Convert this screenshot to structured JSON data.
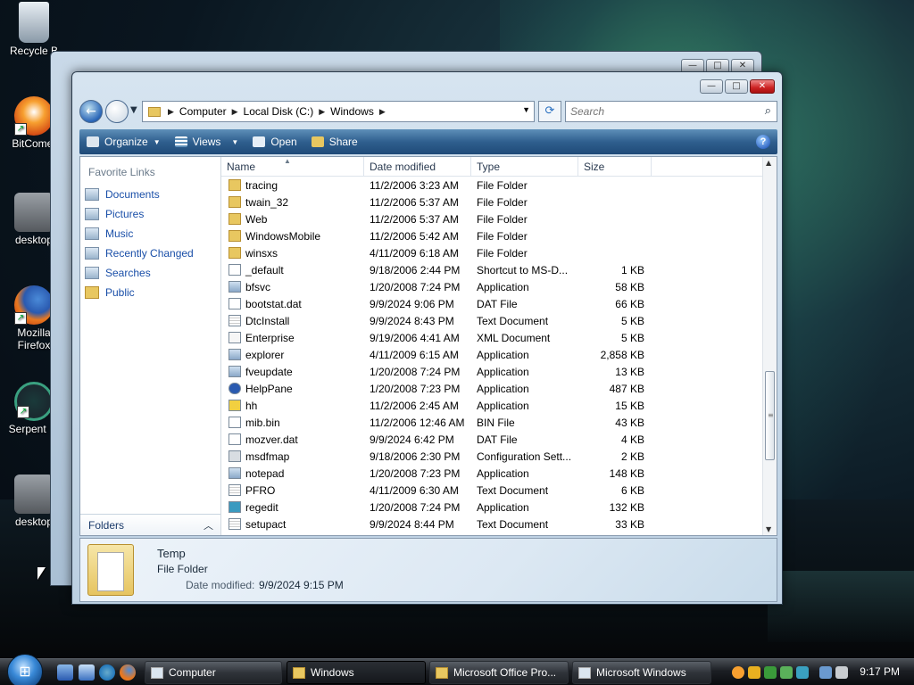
{
  "desktop": {
    "icons": [
      {
        "label": "Recycle B",
        "icon": "recycle-bin-icon"
      },
      {
        "label": "BitComet",
        "icon": "bitcomet-icon"
      },
      {
        "label": "desktop",
        "icon": "gear-file-icon"
      },
      {
        "label": "Mozilla Firefox",
        "icon": "firefox-icon"
      },
      {
        "label": "Serpent IA",
        "icon": "serpent-icon"
      },
      {
        "label": "desktop",
        "icon": "gear-file-icon"
      }
    ]
  },
  "window": {
    "caption_buttons": {
      "minimize": "—",
      "maximize": "□",
      "close": "✕"
    },
    "address": {
      "parts": [
        "Computer",
        "Local Disk (C:)",
        "Windows"
      ]
    },
    "search": {
      "placeholder": "Search"
    },
    "toolbar": {
      "organize": "Organize",
      "views": "Views",
      "open": "Open",
      "share": "Share",
      "help": "?"
    },
    "left_pane": {
      "title": "Favorite Links",
      "links": [
        "Documents",
        "Pictures",
        "Music",
        "Recently Changed",
        "Searches",
        "Public"
      ],
      "folders_label": "Folders"
    },
    "columns": {
      "name": "Name",
      "date": "Date modified",
      "type": "Type",
      "size": "Size"
    },
    "files": [
      {
        "name": "tracing",
        "date": "11/2/2006 3:23 AM",
        "type": "File Folder",
        "size": "",
        "icon": "folder"
      },
      {
        "name": "twain_32",
        "date": "11/2/2006 5:37 AM",
        "type": "File Folder",
        "size": "",
        "icon": "folder"
      },
      {
        "name": "Web",
        "date": "11/2/2006 5:37 AM",
        "type": "File Folder",
        "size": "",
        "icon": "folder"
      },
      {
        "name": "WindowsMobile",
        "date": "11/2/2006 5:42 AM",
        "type": "File Folder",
        "size": "",
        "icon": "folder"
      },
      {
        "name": "winsxs",
        "date": "4/11/2009 6:18 AM",
        "type": "File Folder",
        "size": "",
        "icon": "folder"
      },
      {
        "name": "_default",
        "date": "9/18/2006 2:44 PM",
        "type": "Shortcut to MS-D...",
        "size": "1 KB",
        "icon": "shortcut"
      },
      {
        "name": "bfsvc",
        "date": "1/20/2008 7:24 PM",
        "type": "Application",
        "size": "58 KB",
        "icon": "app"
      },
      {
        "name": "bootstat.dat",
        "date": "9/9/2024 9:06 PM",
        "type": "DAT File",
        "size": "66 KB",
        "icon": "dat"
      },
      {
        "name": "DtcInstall",
        "date": "9/9/2024 8:43 PM",
        "type": "Text Document",
        "size": "5 KB",
        "icon": "txt"
      },
      {
        "name": "Enterprise",
        "date": "9/19/2006 4:41 AM",
        "type": "XML Document",
        "size": "5 KB",
        "icon": "xml"
      },
      {
        "name": "explorer",
        "date": "4/11/2009 6:15 AM",
        "type": "Application",
        "size": "2,858 KB",
        "icon": "app"
      },
      {
        "name": "fveupdate",
        "date": "1/20/2008 7:24 PM",
        "type": "Application",
        "size": "13 KB",
        "icon": "app"
      },
      {
        "name": "HelpPane",
        "date": "1/20/2008 7:23 PM",
        "type": "Application",
        "size": "487 KB",
        "icon": "help"
      },
      {
        "name": "hh",
        "date": "11/2/2006 2:45 AM",
        "type": "Application",
        "size": "15 KB",
        "icon": "hh"
      },
      {
        "name": "mib.bin",
        "date": "11/2/2006 12:46 AM",
        "type": "BIN File",
        "size": "43 KB",
        "icon": "dat"
      },
      {
        "name": "mozver.dat",
        "date": "9/9/2024 6:42 PM",
        "type": "DAT File",
        "size": "4 KB",
        "icon": "dat"
      },
      {
        "name": "msdfmap",
        "date": "9/18/2006 2:30 PM",
        "type": "Configuration Sett...",
        "size": "2 KB",
        "icon": "cfg"
      },
      {
        "name": "notepad",
        "date": "1/20/2008 7:23 PM",
        "type": "Application",
        "size": "148 KB",
        "icon": "app"
      },
      {
        "name": "PFRO",
        "date": "4/11/2009 6:30 AM",
        "type": "Text Document",
        "size": "6 KB",
        "icon": "txt"
      },
      {
        "name": "regedit",
        "date": "1/20/2008 7:24 PM",
        "type": "Application",
        "size": "132 KB",
        "icon": "reg"
      },
      {
        "name": "setupact",
        "date": "9/9/2024 8:44 PM",
        "type": "Text Document",
        "size": "33 KB",
        "icon": "txt"
      }
    ],
    "details": {
      "name": "Temp",
      "type": "File Folder",
      "date_label": "Date modified:",
      "date_value": "9/9/2024 9:15 PM"
    }
  },
  "taskbar": {
    "buttons": [
      {
        "label": "Computer",
        "icon": "computer-icon"
      },
      {
        "label": "Windows",
        "icon": "folder"
      },
      {
        "label": "Microsoft Office Pro...",
        "icon": "folder"
      },
      {
        "label": "Microsoft Windows",
        "icon": "computer-icon"
      }
    ],
    "clock": "9:17 PM"
  }
}
